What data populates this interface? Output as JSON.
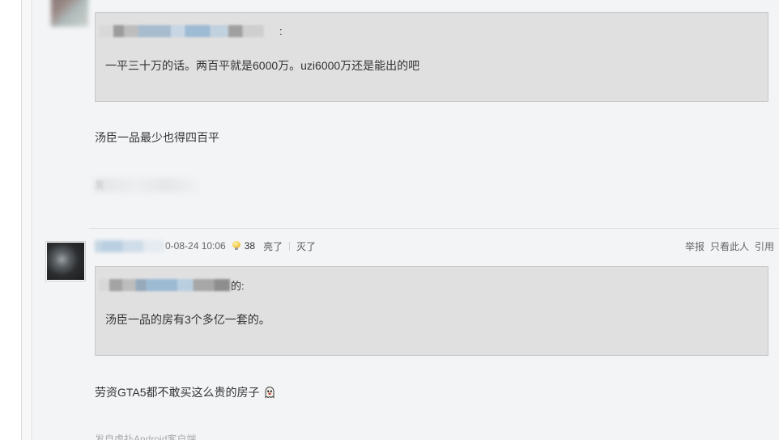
{
  "post1": {
    "quote": {
      "author_suffix": ":",
      "text": "一平三十万的话。两百平就是6000万。uzi6000万还是能出的吧"
    },
    "reply_text": "汤臣一品最少也得四百平",
    "client_glyph": "发"
  },
  "post2": {
    "date": "0-08-24 10:06",
    "light_count": "38",
    "light_label": "亮了",
    "separator": "|",
    "dark_label": "灭了",
    "actions": {
      "report": "举报",
      "only_author": "只看此人",
      "quote": "引用"
    },
    "quote": {
      "author_suffix": "的:",
      "text": "汤臣一品的房有3个多亿一套的。"
    },
    "reply_text": "劳资GTA5都不敢买这么贵的房子",
    "reply_emoji": "ghost-emoji-icon",
    "client_line": "发自虎扑Android客户端"
  },
  "colors": {
    "quote_bg": "#e0e0e0",
    "content_bg": "#f3f4f6",
    "muted_text": "#999999"
  }
}
